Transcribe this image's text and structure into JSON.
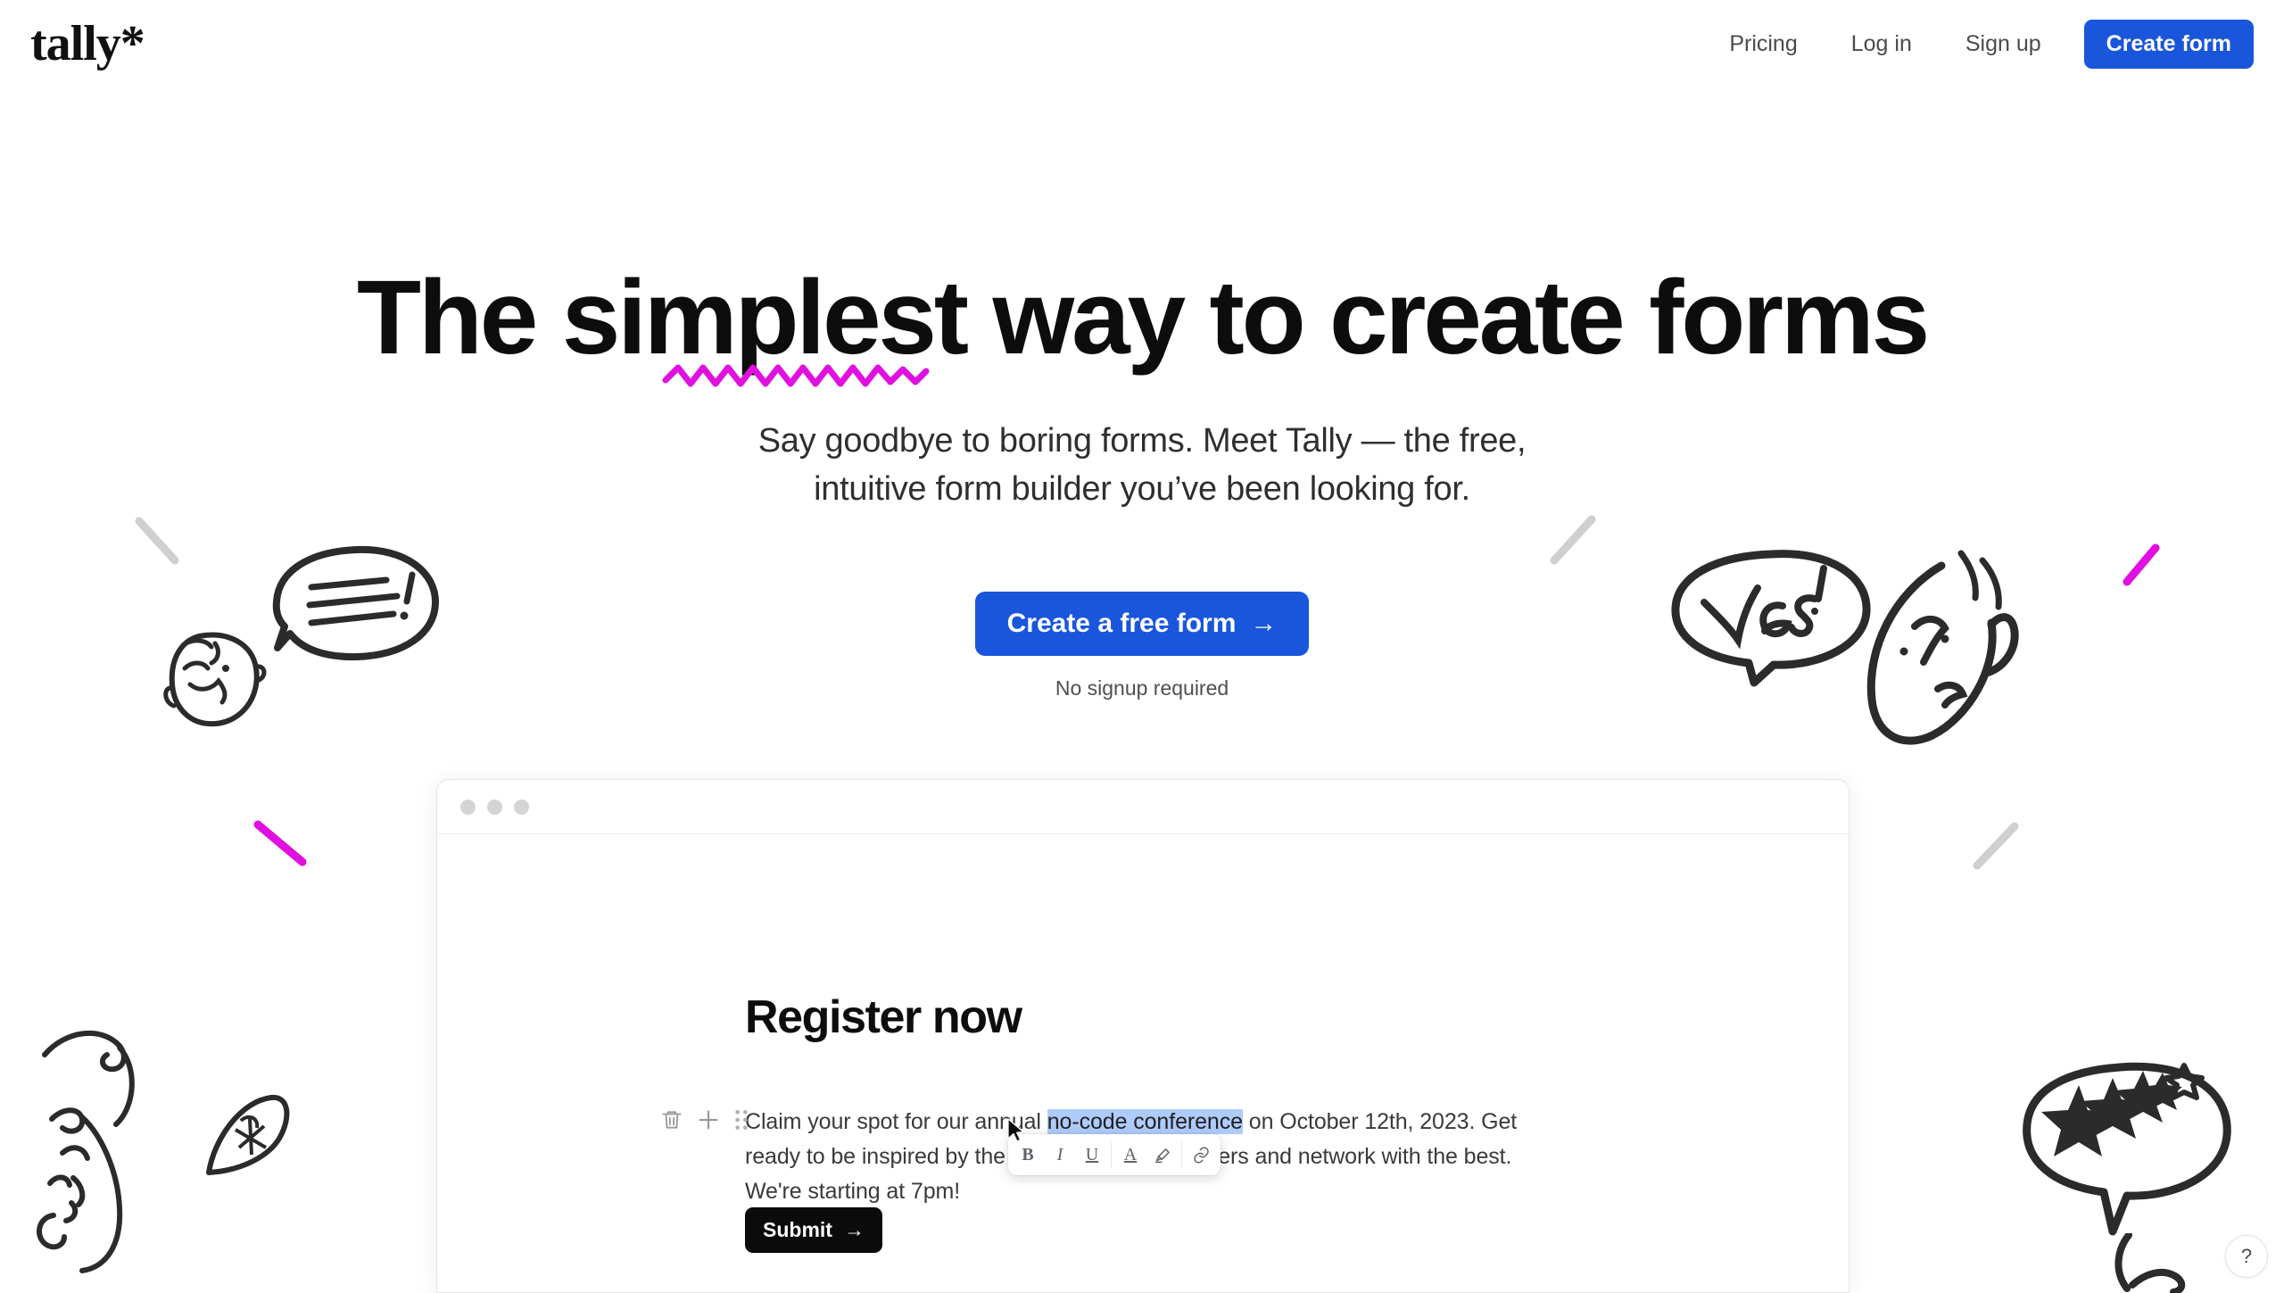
{
  "header": {
    "logo": "tally*",
    "nav": [
      {
        "label": "Pricing",
        "name": "nav-link-pricing"
      },
      {
        "label": "Log in",
        "name": "nav-link-login"
      },
      {
        "label": "Sign up",
        "name": "nav-link-signup"
      }
    ],
    "create_form_label": "Create form"
  },
  "hero": {
    "headline_part1": "The ",
    "headline_emphasis": "simplest",
    "headline_part2": " way to create forms",
    "headline_full": "The simplest way to create forms",
    "subtitle_line1": "Say goodbye to boring forms. Meet Tally — the free,",
    "subtitle_line2": "intuitive form builder you’ve been looking for.",
    "cta_label": "Create a free form",
    "cta_arrow": "→",
    "cta_note": "No signup required"
  },
  "form_preview": {
    "title": "Register now",
    "body_before_selection": "Claim your spot for our annual ",
    "body_selection": "no-code conference",
    "body_after_selection": " on October 12th, 2023. Get ready to be inspired by the industry-grade speakers and network with the best. We're starting at 7pm!",
    "submit_label": "Submit",
    "submit_arrow": "→",
    "block_icons": [
      {
        "name": "trash-icon",
        "glyph": "delete"
      },
      {
        "name": "plus-icon",
        "glyph": "add"
      },
      {
        "name": "drag-handle-icon",
        "glyph": "grip"
      }
    ]
  },
  "rich_text_toolbar": {
    "bold": "B",
    "italic": "I",
    "underline": "U",
    "text_color": "A",
    "highlight": "highlighter-icon",
    "link": "link-icon"
  },
  "help": {
    "label": "?"
  },
  "colors": {
    "accent_blue": "#1a56db",
    "magenta": "#e010e0",
    "ink": "#2b2b2b",
    "selection_blue": "#aecbfa",
    "grey_stroke": "#cfcfcf",
    "submit_black": "#0b0b0b"
  }
}
